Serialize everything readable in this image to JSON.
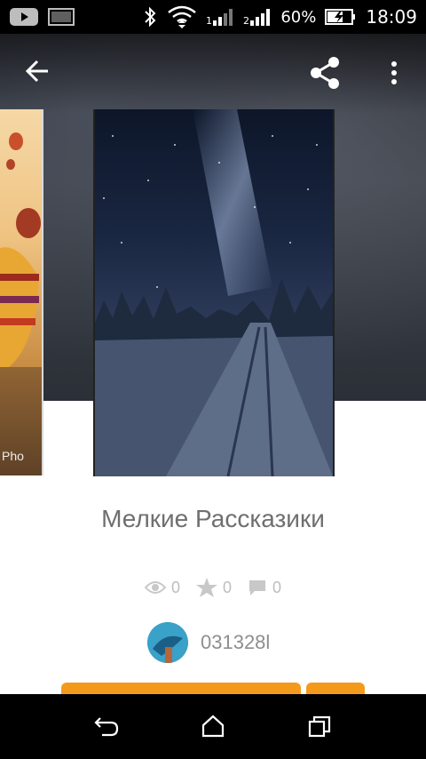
{
  "status_bar": {
    "battery_percent_text": "60%",
    "time": "18:09",
    "icons": [
      "youtube-icon",
      "gallery-icon",
      "bluetooth-icon",
      "wifi-icon",
      "signal-1-icon",
      "signal-2-icon",
      "battery-charging-icon"
    ]
  },
  "toolbar": {
    "back_icon": "arrow-back-icon",
    "share_icon": "share-icon",
    "more_icon": "more-vert-icon"
  },
  "covers": {
    "left_watermark": "Pho"
  },
  "story": {
    "title": "Мелкие Рассказики",
    "views": "0",
    "stars": "0",
    "comments": "0",
    "author": "031328l"
  },
  "colors": {
    "accent": "#f49a1b",
    "title_text": "#6f6f6f",
    "meta_text": "#bdbdbd"
  },
  "nav": {
    "back_icon": "nav-back-icon",
    "home_icon": "nav-home-icon",
    "recents_icon": "nav-recents-icon"
  }
}
